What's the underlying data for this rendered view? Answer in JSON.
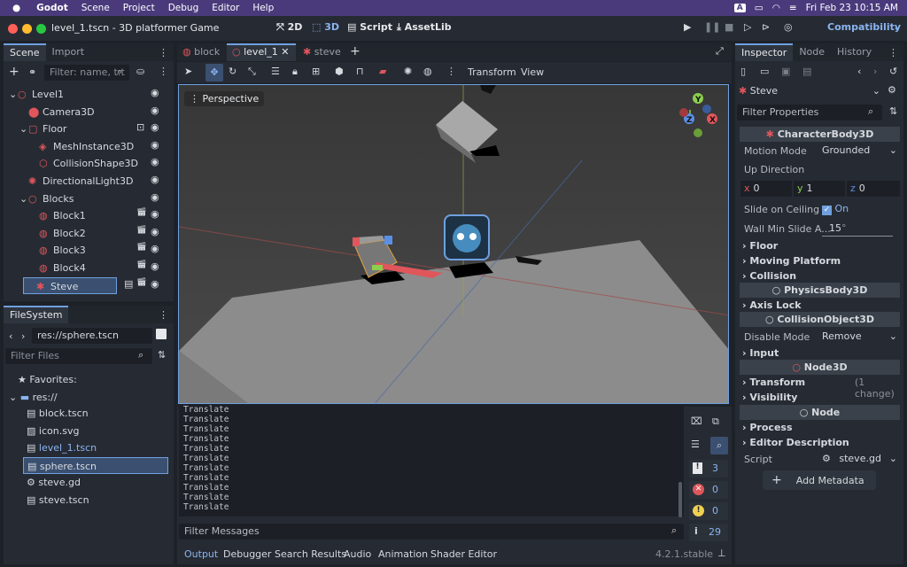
{
  "menubar": {
    "app": "Godot",
    "items": [
      "Scene",
      "Project",
      "Debug",
      "Editor",
      "Help"
    ],
    "clock": "Fri Feb 23  10:15 AM",
    "a_label": "A"
  },
  "titlebar": {
    "title": "level_1.tscn - 3D platformer Game",
    "modes": {
      "m2d": "2D",
      "m3d": "3D",
      "script": "Script",
      "assetlib": "AssetLib"
    },
    "renderer": "Compatibility"
  },
  "scene_dock": {
    "tabs": [
      "Scene",
      "Import"
    ],
    "filter_placeholder": "Filter: name, t:t",
    "nodes": [
      {
        "label": "Level1",
        "indent": 0,
        "arrow": "⌄"
      },
      {
        "label": "Camera3D",
        "indent": 1,
        "arrow": ""
      },
      {
        "label": "Floor",
        "indent": 1,
        "arrow": "⌄"
      },
      {
        "label": "MeshInstance3D",
        "indent": 2,
        "arrow": ""
      },
      {
        "label": "CollisionShape3D",
        "indent": 2,
        "arrow": ""
      },
      {
        "label": "DirectionalLight3D",
        "indent": 1,
        "arrow": ""
      },
      {
        "label": "Blocks",
        "indent": 1,
        "arrow": "⌄"
      },
      {
        "label": "Block1",
        "indent": 2,
        "arrow": ""
      },
      {
        "label": "Block2",
        "indent": 2,
        "arrow": ""
      },
      {
        "label": "Block3",
        "indent": 2,
        "arrow": ""
      },
      {
        "label": "Block4",
        "indent": 2,
        "arrow": ""
      },
      {
        "label": "Steve",
        "indent": 1,
        "arrow": ""
      }
    ]
  },
  "filesystem": {
    "title": "FileSystem",
    "path": "res://sphere.tscn",
    "filter_placeholder": "Filter Files",
    "favorites": "Favorites:",
    "root": "res://",
    "files": [
      "block.tscn",
      "icon.svg",
      "level_1.tscn",
      "sphere.tscn",
      "steve.gd",
      "steve.tscn"
    ]
  },
  "editor_tabs": [
    "block",
    "level_1",
    "steve"
  ],
  "viewport": {
    "perspective": "Perspective",
    "toolbar_menus": [
      "Transform",
      "View"
    ],
    "gizmo": {
      "y": "Y",
      "x": "X",
      "z": "Z"
    }
  },
  "output": {
    "lines": [
      "Translate",
      "Translate",
      "Translate",
      "Translate",
      "Translate",
      "Translate",
      "Translate",
      "Translate",
      "Translate",
      "Translate",
      "Translate"
    ],
    "filter_placeholder": "Filter Messages",
    "counts": {
      "messages": "3",
      "errors": "0",
      "warnings": "0",
      "info": "29"
    },
    "bottom_tabs": [
      "Output",
      "Debugger",
      "Search Results",
      "Audio",
      "Animation",
      "Shader Editor"
    ],
    "version": "4.2.1.stable"
  },
  "inspector": {
    "tabs": [
      "Inspector",
      "Node",
      "History"
    ],
    "object": "Steve",
    "filter_placeholder": "Filter Properties",
    "class1": "CharacterBody3D",
    "motion_mode_label": "Motion Mode",
    "motion_mode_value": "Grounded",
    "up_direction_label": "Up Direction",
    "up": {
      "x": "0",
      "y": "1",
      "z": "0"
    },
    "slide_label": "Slide on Ceiling",
    "slide_value": "On",
    "wall_label": "Wall Min Slide A...",
    "wall_value": "15",
    "wall_unit": "°",
    "sections1": [
      "Floor",
      "Moving Platform",
      "Collision"
    ],
    "class2": "PhysicsBody3D",
    "axis_lock": "Axis Lock",
    "class3": "CollisionObject3D",
    "disable_mode_label": "Disable Mode",
    "disable_mode_value": "Remove",
    "input": "Input",
    "class4": "Node3D",
    "transform": "Transform",
    "transform_change": "(1 change)",
    "visibility": "Visibility",
    "class5": "Node",
    "process": "Process",
    "editor_description": "Editor Description",
    "script_label": "Script",
    "script_value": "steve.gd",
    "add_metadata": "Add Metadata"
  },
  "colors": {
    "accent": "#6fa0e0",
    "selection": "#3b5070",
    "red": "#e0565b",
    "green": "#8ccf4d",
    "blue": "#5b8fe6"
  }
}
